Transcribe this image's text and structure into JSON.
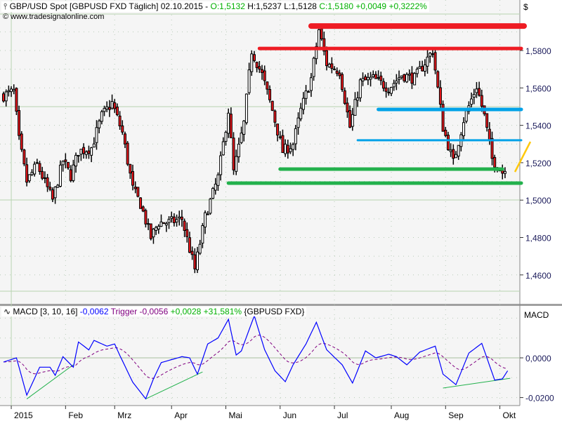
{
  "header": {
    "title": "GBP/USD Spot [GBPUSD FXD  Täglich] 02.10.2015 -",
    "open": "O:1,5132",
    "high": "H:1,5237",
    "low": "L:1,5128",
    "close": "C:1,5180",
    "change": "+0,0049",
    "change_pct": "+0,3222%",
    "copyright": "© www.tradesignalonline.com",
    "currency_label": "$"
  },
  "macd_header": {
    "name": "MACD [3, 10, 16]",
    "value": "-0,0062",
    "trigger_label": "Trigger",
    "trigger_value": "-0,0056",
    "diff": "+0,0028",
    "diff_pct": "+31,581%",
    "symbol": "{GBPUSD FXD}",
    "axis_label": "MACD"
  },
  "colors": {
    "bear": "#e8161b",
    "bull": "#ffffff",
    "macd": "#0000ff",
    "trigger": "#800080",
    "red_line": "#ee1c24",
    "blue_line": "#00a2e8",
    "green_line": "#22b14c",
    "orange_line": "#ffc90e"
  },
  "chart_data": [
    {
      "type": "candlestick",
      "title": "GBP/USD Spot Täglich",
      "ylim": [
        1.445,
        1.605
      ],
      "yticks": [
        "1,5800",
        "1,5600",
        "1,5400",
        "1,5200",
        "1,5000",
        "1,4800",
        "1,4600"
      ],
      "ytick_values": [
        1.58,
        1.56,
        1.54,
        1.52,
        1.5,
        1.48,
        1.46
      ],
      "xticks": [
        "2015",
        "Feb",
        "Mrz",
        "Apr",
        "Mai",
        "Jun",
        "Jul",
        "Aug",
        "Sep",
        "Okt"
      ],
      "xtick_days": [
        3,
        24,
        43,
        65,
        86,
        107,
        128,
        150,
        171,
        192
      ],
      "approx_close_path": [
        [
          0,
          1.556
        ],
        [
          4,
          1.558
        ],
        [
          6,
          1.532
        ],
        [
          9,
          1.51
        ],
        [
          13,
          1.519
        ],
        [
          19,
          1.5
        ],
        [
          23,
          1.521
        ],
        [
          26,
          1.513
        ],
        [
          29,
          1.526
        ],
        [
          34,
          1.528
        ],
        [
          38,
          1.545
        ],
        [
          42,
          1.552
        ],
        [
          46,
          1.536
        ],
        [
          50,
          1.506
        ],
        [
          53,
          1.498
        ],
        [
          57,
          1.48
        ],
        [
          60,
          1.488
        ],
        [
          64,
          1.488
        ],
        [
          69,
          1.49
        ],
        [
          74,
          1.463
        ],
        [
          78,
          1.491
        ],
        [
          83,
          1.512
        ],
        [
          87,
          1.548
        ],
        [
          89,
          1.515
        ],
        [
          93,
          1.541
        ],
        [
          96,
          1.58
        ],
        [
          100,
          1.567
        ],
        [
          104,
          1.548
        ],
        [
          108,
          1.526
        ],
        [
          112,
          1.53
        ],
        [
          115,
          1.548
        ],
        [
          119,
          1.565
        ],
        [
          122,
          1.591
        ],
        [
          125,
          1.573
        ],
        [
          130,
          1.569
        ],
        [
          134,
          1.539
        ],
        [
          138,
          1.563
        ],
        [
          143,
          1.565
        ],
        [
          149,
          1.56
        ],
        [
          154,
          1.567
        ],
        [
          159,
          1.565
        ],
        [
          166,
          1.58
        ],
        [
          170,
          1.539
        ],
        [
          174,
          1.52
        ],
        [
          178,
          1.543
        ],
        [
          183,
          1.561
        ],
        [
          186,
          1.545
        ],
        [
          189,
          1.522
        ],
        [
          193,
          1.515
        ],
        [
          194,
          1.518
        ]
      ],
      "levels": [
        {
          "price": 1.5931,
          "color": "red",
          "from_day": 119
        },
        {
          "price": 1.5811,
          "color": "red",
          "from_day": 99
        },
        {
          "price": 1.5485,
          "color": "blue",
          "from_day": 145
        },
        {
          "price": 1.532,
          "color": "blue",
          "from_day": 137
        },
        {
          "price": 1.5166,
          "color": "green",
          "from_day": 107,
          "to_day": 193
        },
        {
          "price": 1.5091,
          "color": "green",
          "from_day": 87
        }
      ]
    },
    {
      "type": "line",
      "title": "MACD [3, 10, 16]",
      "ylim": [
        -0.025,
        0.025
      ],
      "yticks": [
        "0,0000",
        "-0,0200"
      ],
      "ytick_values": [
        0,
        -0.02
      ],
      "series": [
        {
          "name": "MACD",
          "points": [
            [
              0,
              -0.0021
            ],
            [
              5,
              0
            ],
            [
              9,
              -0.0188
            ],
            [
              14,
              -0.0047
            ],
            [
              18,
              -0.0047
            ],
            [
              20,
              -0.0088
            ],
            [
              23,
              0.0006
            ],
            [
              27,
              -0.0047
            ],
            [
              29,
              0.008
            ],
            [
              33,
              0.004
            ],
            [
              35,
              0.0088
            ],
            [
              40,
              0.0059
            ],
            [
              43,
              0.007
            ],
            [
              45,
              0.0012
            ],
            [
              50,
              -0.0123
            ],
            [
              55,
              -0.0206
            ],
            [
              58,
              -0.0106
            ],
            [
              61,
              -0.0024
            ],
            [
              69,
              0.0006
            ],
            [
              72,
              0.0
            ],
            [
              75,
              -0.0082
            ],
            [
              79,
              0.007
            ],
            [
              83,
              0.01
            ],
            [
              87,
              0.0194
            ],
            [
              90,
              0.0014
            ],
            [
              92,
              0.0035
            ],
            [
              97,
              0.0212
            ],
            [
              101,
              0.0041
            ],
            [
              105,
              -0.0065
            ],
            [
              109,
              -0.012
            ],
            [
              112,
              -0.0035
            ],
            [
              117,
              0.007
            ],
            [
              121,
              0.0179
            ],
            [
              125,
              0.0041
            ],
            [
              131,
              -0.0035
            ],
            [
              135,
              -0.0127
            ],
            [
              140,
              0.0035
            ],
            [
              144,
              0
            ],
            [
              149,
              0.0018
            ],
            [
              152,
              0.0006
            ],
            [
              156,
              -0.0035
            ],
            [
              161,
              0.0029
            ],
            [
              167,
              0.0059
            ],
            [
              170,
              -0.0082
            ],
            [
              175,
              -0.0135
            ],
            [
              180,
              0.0024
            ],
            [
              185,
              0.0073
            ],
            [
              190,
              -0.0112
            ],
            [
              193,
              -0.0106
            ],
            [
              195,
              -0.0065
            ]
          ]
        },
        {
          "name": "Trigger",
          "derived": "ema of MACD"
        }
      ],
      "trendlines": [
        [
          [
            9,
            -0.0207
          ],
          [
            27,
            -0.0035
          ]
        ],
        [
          [
            55,
            -0.0207
          ],
          [
            77,
            -0.0071
          ]
        ],
        [
          [
            170,
            -0.0152
          ],
          [
            196,
            -0.0103
          ]
        ]
      ]
    }
  ]
}
